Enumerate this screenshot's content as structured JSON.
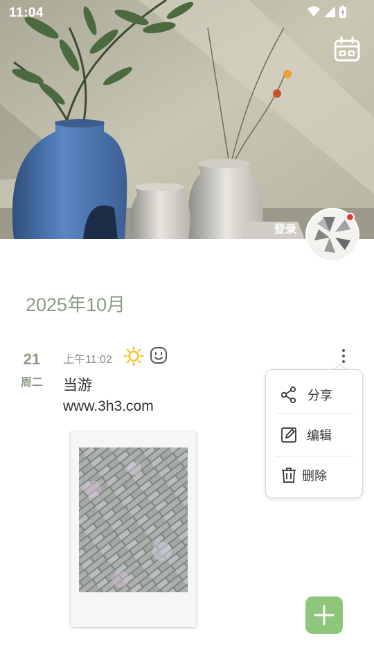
{
  "status_bar": {
    "time": "11:04",
    "icons": [
      "wifi-icon",
      "signal-icon",
      "battery-icon"
    ]
  },
  "header": {
    "login_label": "登录",
    "notification_color": "#e53935"
  },
  "month_title": "2025年10月",
  "entry": {
    "day": "21",
    "weekday": "周二",
    "time": "上午11:02",
    "weather_icon": "sun-icon",
    "mood_icon": "smile-icon",
    "text_line1": "当游",
    "text_line2": "www.3h3.com"
  },
  "context_menu": {
    "items": [
      {
        "label": "分享",
        "icon": "share-icon"
      },
      {
        "label": "编辑",
        "icon": "edit-icon"
      },
      {
        "label": "删除",
        "icon": "trash-icon"
      }
    ]
  },
  "colors": {
    "accent": "#8c9a84",
    "fab": "#8ec77c",
    "sun": "#f2c12e"
  }
}
